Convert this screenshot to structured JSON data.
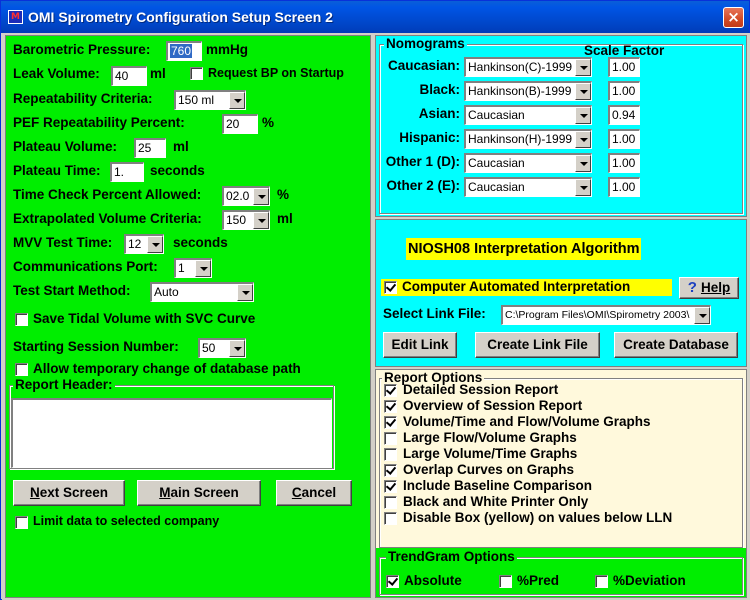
{
  "window": {
    "title": "OMI Spirometry Configuration Setup Screen 2",
    "close_glyph": "×",
    "logo_text": "M"
  },
  "left": {
    "barometric_label": "Barometric Pressure:",
    "barometric_value": "760",
    "barometric_unit": "mmHg",
    "leak_label": "Leak Volume:",
    "leak_value": "40",
    "leak_unit": "ml",
    "request_bp_label": "Request BP on Startup",
    "request_bp_checked": false,
    "repeatability_label": "Repeatability Criteria:",
    "repeatability_value": "150 ml",
    "pef_label": "PEF Repeatability Percent:",
    "pef_value": "20",
    "pef_unit": "%",
    "plateau_volume_label": "Plateau Volume:",
    "plateau_volume_value": "25",
    "plateau_volume_unit": "ml",
    "plateau_time_label": "Plateau Time:",
    "plateau_time_value": "1.",
    "plateau_time_unit": "seconds",
    "time_check_label": "Time Check Percent Allowed:",
    "time_check_value": "02.0",
    "time_check_unit": "%",
    "extrap_label": "Extrapolated Volume Criteria:",
    "extrap_value": "150",
    "extrap_unit": "ml",
    "mvv_label": "MVV Test Time:",
    "mvv_value": "12",
    "mvv_unit": "seconds",
    "comm_label": "Communications Port:",
    "comm_value": "1",
    "test_start_label": "Test Start Method:",
    "test_start_value": "Auto",
    "save_tidal_label": "Save Tidal Volume with SVC Curve",
    "save_tidal_checked": false,
    "session_label": "Starting Session Number:",
    "session_value": "50",
    "allow_temp_label": "Allow temporary change of database path",
    "allow_temp_checked": false,
    "report_header_label": "Report Header:",
    "report_header_value": "",
    "next_screen_label": "Next Screen",
    "next_screen_hotkey": "N",
    "main_screen_label": "Main Screen",
    "main_screen_hotkey": "M",
    "cancel_label": "Cancel",
    "cancel_hotkey": "C",
    "limit_label": "Limit data to selected company",
    "limit_checked": false
  },
  "nomograms": {
    "group_title": "Nomograms",
    "scale_header": "Scale Factor",
    "rows": [
      {
        "label": "Caucasian:",
        "value": "Hankinson(C)-1999",
        "scale": "1.00"
      },
      {
        "label": "Black:",
        "value": "Hankinson(B)-1999",
        "scale": "1.00"
      },
      {
        "label": "Asian:",
        "value": "Caucasian",
        "scale": "0.94"
      },
      {
        "label": "Hispanic:",
        "value": "Hankinson(H)-1999",
        "scale": "1.00"
      },
      {
        "label": "Other 1 (D):",
        "value": "Caucasian",
        "scale": "1.00"
      },
      {
        "label": "Other 2 (E):",
        "value": "Caucasian",
        "scale": "1.00"
      }
    ]
  },
  "interpretation": {
    "algorithm_label": "NIOSH08 Interpretation Algorithm",
    "computer_auto_label": "Computer Automated Interpretation",
    "computer_auto_checked": true,
    "help_label": "Help",
    "help_glyph": "?",
    "link_file_label": "Select Link File:",
    "link_file_value": "C:\\Program Files\\OMI\\Spirometry 2003\\",
    "edit_link_label": "Edit Link",
    "create_link_label": "Create Link File",
    "create_db_label": "Create Database"
  },
  "report_options": {
    "group_title": "Report Options",
    "items": [
      {
        "label": "Detailed Session Report",
        "checked": true
      },
      {
        "label": "Overview of Session Report",
        "checked": true
      },
      {
        "label": "Volume/Time and Flow/Volume Graphs",
        "checked": true
      },
      {
        "label": "Large Flow/Volume Graphs",
        "checked": false
      },
      {
        "label": "Large Volume/Time Graphs",
        "checked": false
      },
      {
        "label": "Overlap Curves on Graphs",
        "checked": true
      },
      {
        "label": "Include Baseline Comparison",
        "checked": true
      },
      {
        "label": "Black and White Printer Only",
        "checked": false
      },
      {
        "label": "Disable Box (yellow) on values below LLN",
        "checked": false
      }
    ]
  },
  "trendgram": {
    "group_title": "TrendGram Options",
    "absolute_label": "Absolute",
    "absolute_checked": true,
    "pred_label": "%Pred",
    "pred_checked": false,
    "deviation_label": "%Deviation",
    "deviation_checked": false
  },
  "colors": {
    "left_panel": "#00ee00",
    "nomogram_panel": "#00ffff",
    "report_panel": "#fff9dc",
    "highlight_yellow": "#ffff00",
    "titlebar": "#0055e5"
  }
}
